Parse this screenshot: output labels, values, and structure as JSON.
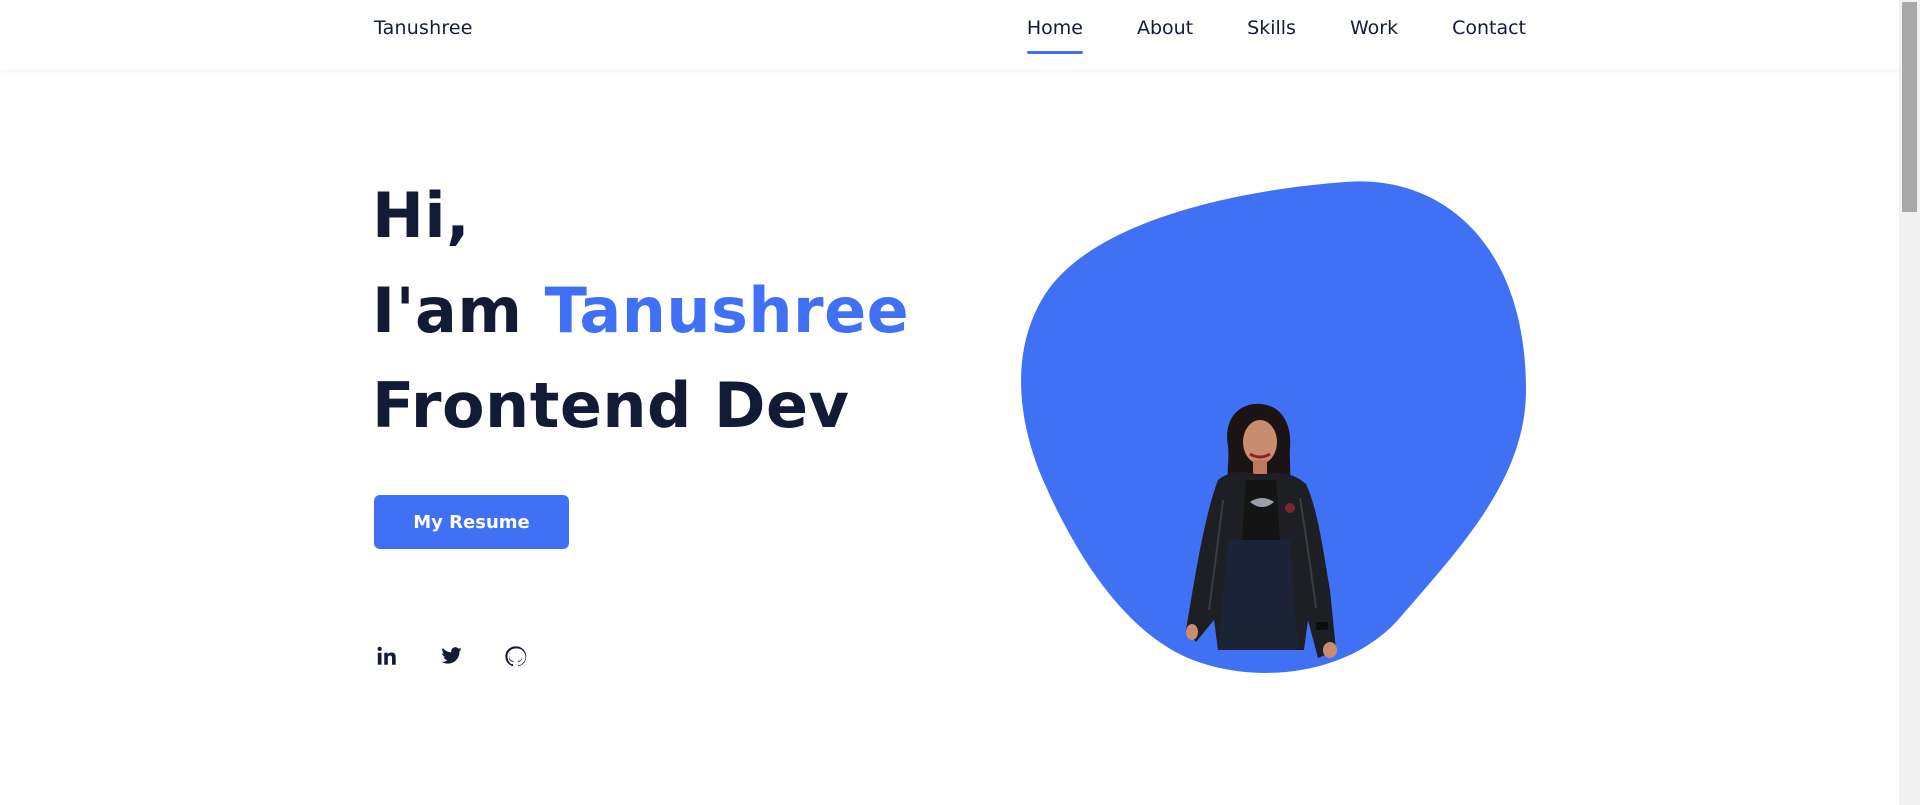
{
  "header": {
    "logo": "Tanushree",
    "nav": [
      {
        "label": "Home",
        "active": true
      },
      {
        "label": "About",
        "active": false
      },
      {
        "label": "Skills",
        "active": false
      },
      {
        "label": "Work",
        "active": false
      },
      {
        "label": "Contact",
        "active": false
      }
    ]
  },
  "hero": {
    "line1": "Hi,",
    "line2_prefix": "I'am ",
    "line2_name": "Tanushree",
    "line3": "Frontend Dev",
    "button_label": "My Resume",
    "socials": [
      "linkedin-icon",
      "twitter-icon",
      "github-icon"
    ]
  },
  "colors": {
    "accent": "#4070f4",
    "text": "#121b35",
    "background": "#ffffff"
  }
}
